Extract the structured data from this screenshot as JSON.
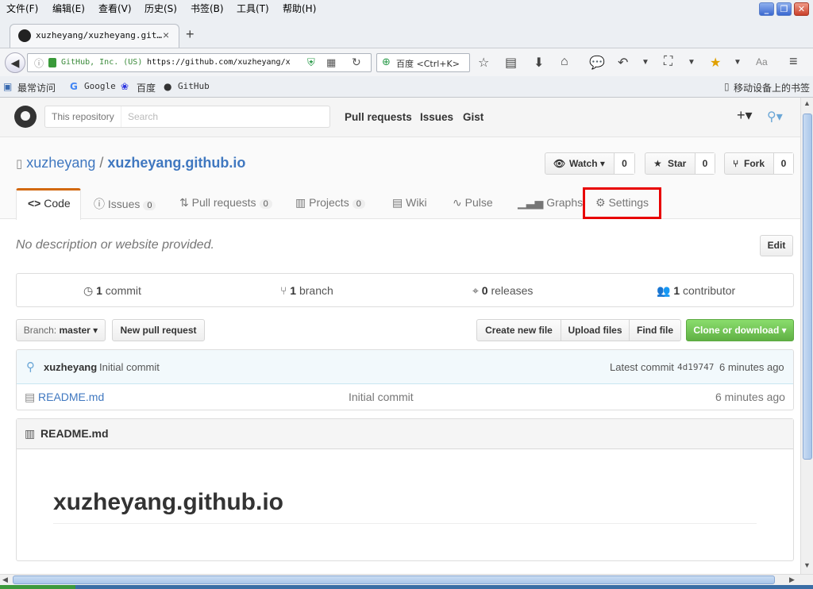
{
  "menu": [
    "文件(F)",
    "编辑(E)",
    "查看(V)",
    "历史(S)",
    "书签(B)",
    "工具(T)",
    "帮助(H)"
  ],
  "tab": {
    "title": "xuzheyang/xuzheyang.git…",
    "close": "×",
    "new": "+"
  },
  "address": {
    "site": "GitHub, Inc. (US)",
    "url": "https://github.com/xuzheyang/x"
  },
  "search_engine": {
    "text": "百度 <Ctrl+K>"
  },
  "bookmarks": [
    "最常访问",
    "Google",
    "百度",
    "GitHub",
    "移动设备上的书签"
  ],
  "github": {
    "search_scope": "This repository",
    "search_placeholder": "Search",
    "nav": [
      "Pull requests",
      "Issues",
      "Gist"
    ],
    "plus": "+▾"
  },
  "repo": {
    "owner": "xuzheyang",
    "sep": "/",
    "name": "xuzheyang.github.io",
    "watch": "Watch ▾",
    "watch_count": "0",
    "star": "Star",
    "star_count": "0",
    "fork": "Fork",
    "fork_count": "0",
    "tabs": [
      {
        "label": "Code"
      },
      {
        "label": "Issues",
        "count": "0"
      },
      {
        "label": "Pull requests",
        "count": "0"
      },
      {
        "label": "Projects",
        "count": "0"
      },
      {
        "label": "Wiki"
      },
      {
        "label": "Pulse"
      },
      {
        "label": "Graphs"
      },
      {
        "label": "Settings"
      }
    ],
    "description": "No description or website provided.",
    "edit": "Edit",
    "summary": {
      "commits_n": "1",
      "commits_l": "commit",
      "branches_n": "1",
      "branches_l": "branch",
      "releases_n": "0",
      "releases_l": "releases",
      "contrib_n": "1",
      "contrib_l": "contributor"
    },
    "branch_label": "Branch:",
    "branch": "master ▾",
    "new_pr": "New pull request",
    "create_file": "Create new file",
    "upload": "Upload files",
    "find": "Find file",
    "clone": "Clone or download ▾",
    "commit": {
      "author": "xuzheyang",
      "message": "Initial commit",
      "latest": "Latest commit",
      "sha": "4d19747",
      "time": "6 minutes ago"
    },
    "file": {
      "name": "README.md",
      "message": "Initial commit",
      "time": "6 minutes ago"
    },
    "readme_title": "README.md",
    "readme_h1": "xuzheyang.github.io"
  }
}
